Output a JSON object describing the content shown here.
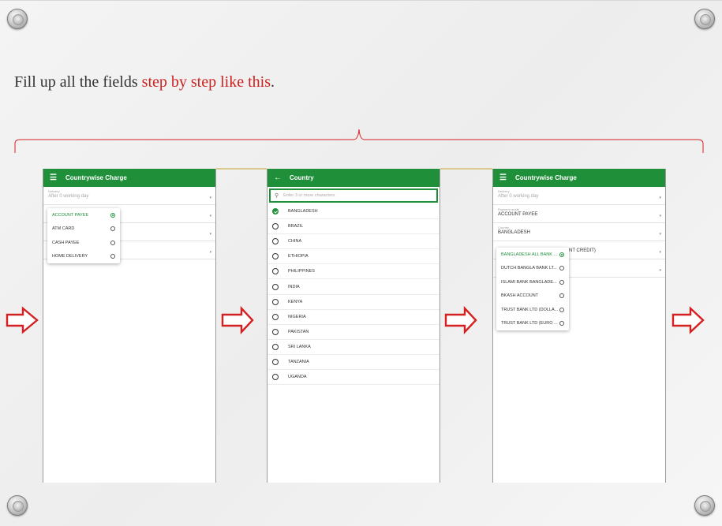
{
  "slide": {
    "headline_plain": "Fill up all the fields ",
    "headline_accent": "step by step like this",
    "headline_end": ".",
    "accent_color": "#cc1f1f"
  },
  "colors": {
    "appbar": "#1f8f3a",
    "arrow": "#d42020"
  },
  "phone1": {
    "appbar_title": "Countrywise Charge",
    "menu_icon": "menu-icon",
    "fields": [
      {
        "label": "Delivery",
        "value": "After 0 working day"
      }
    ],
    "popup_options": [
      {
        "label": "ACCOUNT PAYEE",
        "selected": true
      },
      {
        "label": "ATM CARD",
        "selected": false
      },
      {
        "label": "CASH PAYEE",
        "selected": false
      },
      {
        "label": "HOME DELIVERY",
        "selected": false
      }
    ]
  },
  "phone2": {
    "appbar_title": "Country",
    "back_icon": "arrow-left-icon",
    "search_placeholder": "Enter 3 or more characters",
    "countries": [
      {
        "name": "BANGLADESH",
        "checked": true
      },
      {
        "name": "BRAZIL",
        "checked": false
      },
      {
        "name": "CHINA",
        "checked": false
      },
      {
        "name": "ETHIOPIA",
        "checked": false
      },
      {
        "name": "PHILIPPINES",
        "checked": false
      },
      {
        "name": "INDIA",
        "checked": false
      },
      {
        "name": "KENYA",
        "checked": false
      },
      {
        "name": "NIGERIA",
        "checked": false
      },
      {
        "name": "PAKISTAN",
        "checked": false
      },
      {
        "name": "SRI LANKA",
        "checked": false
      },
      {
        "name": "TANZANIA",
        "checked": false
      },
      {
        "name": "UGANDA",
        "checked": false
      }
    ]
  },
  "phone3": {
    "appbar_title": "Countrywise Charge",
    "menu_icon": "menu-icon",
    "fields": [
      {
        "label": "Delivery",
        "value": "After 0 working day"
      },
      {
        "label": "Payment mode",
        "value": "ACCOUNT PAYEE"
      },
      {
        "label": "Country",
        "value": "BANGLADESH"
      },
      {
        "label": "",
        "value": "NT CREDIT)"
      }
    ],
    "popup_options": [
      {
        "label": "BANGLADESH ALL BANK ...",
        "selected": true
      },
      {
        "label": "DUTCH BANGLA BANK LT...",
        "selected": false
      },
      {
        "label": "ISLAMI BANK BANGLADE...",
        "selected": false
      },
      {
        "label": "BKASH ACCOUNT",
        "selected": false
      },
      {
        "label": "TRUST BANK LTD (DOLLA...",
        "selected": false
      },
      {
        "label": "TRUST BANK LTD (EURO ...",
        "selected": false
      }
    ]
  }
}
